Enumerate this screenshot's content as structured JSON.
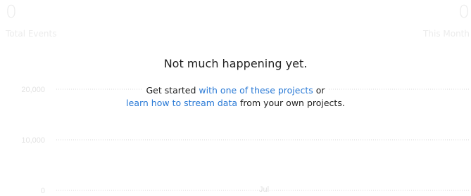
{
  "stats": {
    "total_events": {
      "value": "0",
      "label": "Total Events"
    },
    "this_month": {
      "value": "0",
      "label": "This Month"
    }
  },
  "empty_state": {
    "title": "Not much happening yet.",
    "line1_prefix": "Get started",
    "line1_link": "with one of these projects",
    "line1_suffix": "or",
    "line2_link": "learn how to stream data",
    "line2_suffix": "from your own projects."
  },
  "chart_data": {
    "type": "line",
    "x": [
      "Jul"
    ],
    "series": [],
    "ylim": [
      0,
      20000
    ],
    "yticks": [
      "20,000",
      "10,000",
      "0"
    ],
    "xlabel": "",
    "ylabel": "",
    "grid": true
  },
  "colors": {
    "link": "#2a7ad6",
    "muted": "#ececec",
    "text": "#222222"
  }
}
